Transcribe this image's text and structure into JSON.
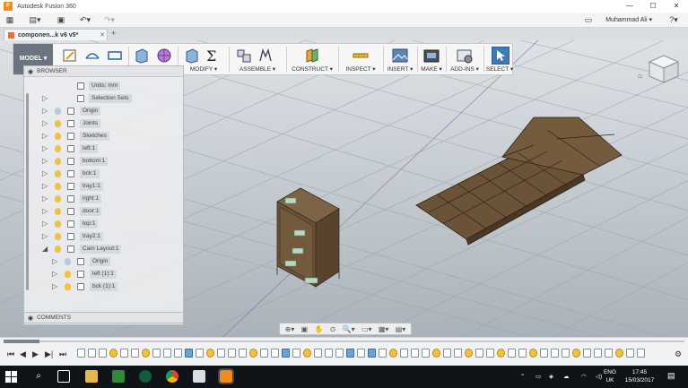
{
  "window": {
    "title": "Autodesk Fusion 360",
    "controls": [
      "—",
      "☐",
      "✕"
    ]
  },
  "appbar": {
    "user_name": "Muhammad Ali",
    "user_caret": "▾",
    "help": "?",
    "help_caret": "▾"
  },
  "tab": {
    "label": "componen...k v6 v5*",
    "close": "✕",
    "new": "+"
  },
  "toolbar": {
    "workspace": "MODEL ▾",
    "groups": {
      "modify": "MODIFY ▾",
      "assemble": "ASSEMBLE ▾",
      "construct": "CONSTRUCT ▾",
      "inspect": "INSPECT ▾",
      "insert": "INSERT ▾",
      "make": "MAKE ▾",
      "addins": "ADD-INS ▾",
      "select": "SELECT ▾"
    }
  },
  "browser": {
    "title": "BROWSER",
    "items": [
      {
        "label": "Units: mm"
      },
      {
        "label": "Selection Sets"
      },
      {
        "label": "Origin"
      },
      {
        "label": "Joints"
      },
      {
        "label": "Sketches"
      },
      {
        "label": "left:1"
      },
      {
        "label": "bottom:1"
      },
      {
        "label": "bck:1"
      },
      {
        "label": "tray1:1"
      },
      {
        "label": "right:1"
      },
      {
        "label": "door:1"
      },
      {
        "label": "top:1"
      },
      {
        "label": "tray2:1"
      },
      {
        "label": "Cam Layout:1"
      },
      {
        "label": "Origin"
      },
      {
        "label": "left (1):1"
      },
      {
        "label": "bck (1):1"
      }
    ]
  },
  "comments": {
    "title": "COMMENTS"
  },
  "viewcube": {
    "face": "FRONT"
  },
  "colors": {
    "accent": "#f28a1e",
    "wood": "#6b5338",
    "grid": "#9aa3aa"
  },
  "taskbar": {
    "lang": "ENG",
    "region": "UK",
    "time": "17:45",
    "date": "15/03/2017"
  }
}
